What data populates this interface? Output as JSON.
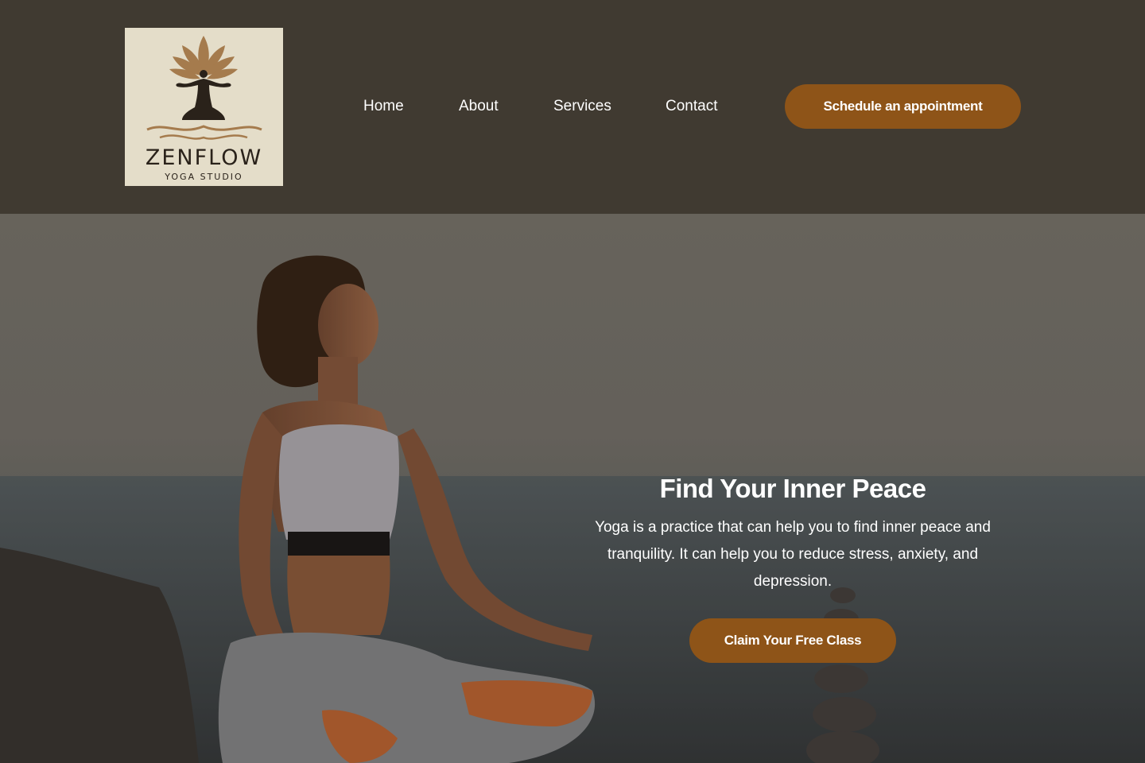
{
  "brand": {
    "name": "ZENFLOW",
    "tagline": "YOGA STUDIO"
  },
  "nav": {
    "items": [
      {
        "label": "Home"
      },
      {
        "label": "About"
      },
      {
        "label": "Services"
      },
      {
        "label": "Contact"
      }
    ],
    "cta_label": "Schedule an appointment"
  },
  "hero": {
    "title": "Find Your Inner Peace",
    "text": "Yoga is a practice that can help you to find inner peace and tranquility. It can help you to reduce stress, anxiety, and depression.",
    "cta_label": "Claim Your Free Class"
  },
  "colors": {
    "header_bg": "#403a31",
    "accent": "#8e5418",
    "logo_bg": "#e4ddc9"
  }
}
